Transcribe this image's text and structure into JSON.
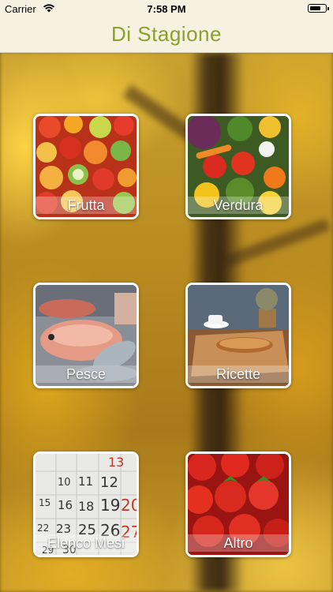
{
  "status_bar": {
    "carrier": "Carrier",
    "time": "7:58 PM"
  },
  "navbar": {
    "title": "Di Stagione"
  },
  "tiles": [
    {
      "label": "Frutta",
      "icon": "fruit-image"
    },
    {
      "label": "Verdura",
      "icon": "vegetables-image"
    },
    {
      "label": "Pesce",
      "icon": "fish-image"
    },
    {
      "label": "Ricette",
      "icon": "recipes-image"
    },
    {
      "label": "Elenco Mesi",
      "icon": "calendar-image"
    },
    {
      "label": "Altro",
      "icon": "strawberries-image"
    }
  ],
  "colors": {
    "title": "#8aa12a",
    "bar_background": "#f7f1e1"
  }
}
